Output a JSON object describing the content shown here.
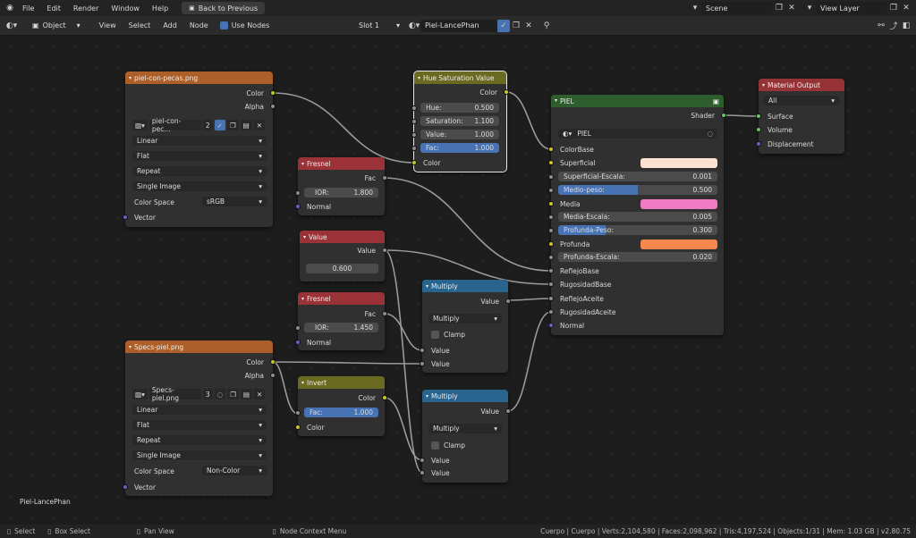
{
  "topbar": {
    "menus": [
      "File",
      "Edit",
      "Render",
      "Window",
      "Help"
    ],
    "back_button": "Back to Previous",
    "scene": "Scene",
    "view_layer": "View Layer"
  },
  "header": {
    "mode": "Object",
    "menus": [
      "View",
      "Select",
      "Add",
      "Node"
    ],
    "use_nodes": "Use Nodes",
    "slot": "Slot 1",
    "material": "Piel-LancePhan"
  },
  "editor_label": "Piel-LancePhan",
  "nodes": {
    "img1": {
      "title": "piel-con-pecas.png",
      "out_color": "Color",
      "out_alpha": "Alpha",
      "image_name": "piel-con-pec...",
      "users": "2",
      "interp": "Linear",
      "proj": "Flat",
      "ext": "Repeat",
      "source": "Single Image",
      "colorspace_label": "Color Space",
      "colorspace": "sRGB",
      "in_vector": "Vector"
    },
    "hsv": {
      "title": "Hue Saturation Value",
      "out_color": "Color",
      "hue_label": "Hue:",
      "hue": "0.500",
      "sat_label": "Saturation:",
      "sat": "1.100",
      "val_label": "Value:",
      "val": "1.000",
      "fac_label": "Fac:",
      "fac": "1.000",
      "in_color": "Color"
    },
    "fresnel1": {
      "title": "Fresnel",
      "out_fac": "Fac",
      "ior_label": "IOR:",
      "ior": "1.800",
      "in_normal": "Normal"
    },
    "value": {
      "title": "Value",
      "out_value": "Value",
      "value": "0.600"
    },
    "fresnel2": {
      "title": "Fresnel",
      "out_fac": "Fac",
      "ior_label": "IOR:",
      "ior": "1.450",
      "in_normal": "Normal"
    },
    "mult1": {
      "title": "Multiply",
      "out_value": "Value",
      "op": "Multiply",
      "clamp": "Clamp",
      "in1": "Value",
      "in2": "Value"
    },
    "img2": {
      "title": "Specs-piel.png",
      "out_color": "Color",
      "out_alpha": "Alpha",
      "image_name": "Specs-piel.png",
      "users": "3",
      "interp": "Linear",
      "proj": "Flat",
      "ext": "Repeat",
      "source": "Single Image",
      "colorspace_label": "Color Space",
      "colorspace": "Non-Color",
      "in_vector": "Vector"
    },
    "invert": {
      "title": "Invert",
      "out_color": "Color",
      "fac_label": "Fac:",
      "fac": "1.000",
      "in_color": "Color"
    },
    "mult2": {
      "title": "Multiply",
      "out_value": "Value",
      "op": "Multiply",
      "clamp": "Clamp",
      "in1": "Value",
      "in2": "Value"
    },
    "piel": {
      "title": "PIEL",
      "out_shader": "Shader",
      "group_name": "PIEL",
      "in_colorbase": "ColorBase",
      "in_superficial": "Superficial",
      "superficial_color": "#fde2d2",
      "superficial_escala_label": "Superficial-Escala:",
      "superficial_escala": "0.001",
      "medio_peso_label": "Medio-peso:",
      "medio_peso": "0.500",
      "medio_peso_fill": 0.5,
      "in_media": "Media",
      "media_color": "#f07bc4",
      "media_escala_label": "Media-Escala:",
      "media_escala": "0.005",
      "profunda_peso_label": "Profunda-Peso:",
      "profunda_peso": "0.300",
      "profunda_peso_fill": 0.3,
      "in_profunda": "Profunda",
      "profunda_color": "#f7874e",
      "profunda_escala_label": "Profunda-Escala:",
      "profunda_escala": "0.020",
      "in_reflejobase": "ReflejoBase",
      "in_rugosidadbase": "RugosidadBase",
      "in_reflejoaceite": "ReflejoAceite",
      "in_rugosidadaceite": "RugosidadAceite",
      "in_normal": "Normal"
    },
    "matout": {
      "title": "Material Output",
      "target": "All",
      "in_surface": "Surface",
      "in_volume": "Volume",
      "in_displacement": "Displacement"
    }
  },
  "statusbar": {
    "select": "Select",
    "box_select": "Box Select",
    "pan_view": "Pan View",
    "context_menu": "Node Context Menu",
    "stats": "Cuerpo | Cuerpo | Verts:2,104,580 | Faces:2,098,962 | Tris:4,197,524 | Objects:1/31 | Mem: 1.03 GB | v2.80.75"
  }
}
